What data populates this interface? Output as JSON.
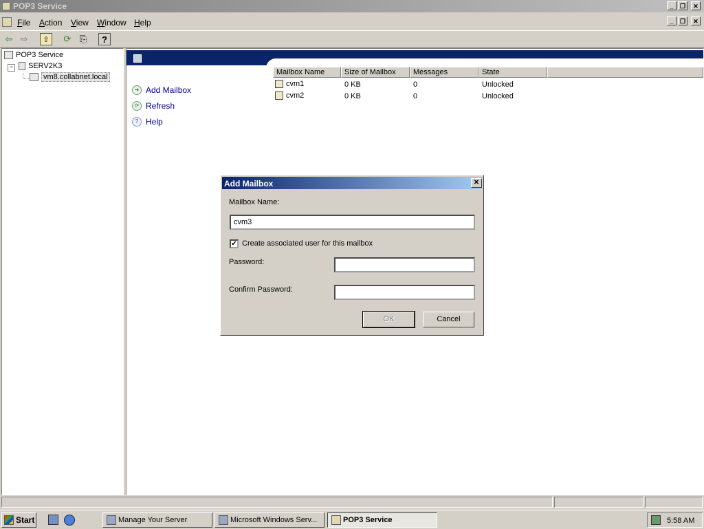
{
  "window": {
    "title": "POP3 Service",
    "min": "_",
    "restore": "❐",
    "close": "✕"
  },
  "menu": {
    "file": {
      "hotkey": "F",
      "rest": "ile"
    },
    "action": {
      "hotkey": "A",
      "rest": "ction"
    },
    "view": {
      "hotkey": "V",
      "rest": "iew"
    },
    "window": {
      "hotkey": "W",
      "rest": "indow"
    },
    "help": {
      "hotkey": "H",
      "rest": "elp"
    }
  },
  "toolbar": {
    "back": "⇦",
    "forward": "⇨",
    "up": "⇧",
    "refresh": "⟳",
    "export": "⎘",
    "helpq": "?"
  },
  "tree": {
    "root": "POP3 Service",
    "server": "SERV2K3",
    "domain": "vm8.collabnet.local",
    "expander": "−"
  },
  "actions": [
    {
      "label": "Add Mailbox",
      "glyph": "➔"
    },
    {
      "label": "Refresh",
      "glyph": "⟳"
    },
    {
      "label": "Help",
      "glyph": "?"
    }
  ],
  "list": {
    "columns": [
      "Mailbox Name",
      "Size of Mailbox",
      "Messages",
      "State"
    ],
    "rows": [
      {
        "name": "cvm1",
        "size": "0 KB",
        "messages": "0",
        "state": "Unlocked"
      },
      {
        "name": "cvm2",
        "size": "0 KB",
        "messages": "0",
        "state": "Unlocked"
      }
    ]
  },
  "dialog": {
    "title": "Add Mailbox",
    "close": "✕",
    "mailbox_label": "Mailbox Name:",
    "mailbox_value": "cvm3",
    "checkbox_label": "Create associated user for this mailbox",
    "checkbox_mark": "✔",
    "password_label": "Password:",
    "password_value": "",
    "confirm_label": "Confirm Password:",
    "confirm_value": "",
    "ok": "OK",
    "cancel": "Cancel"
  },
  "taskbar": {
    "start": "Start",
    "tasks": [
      "Manage Your Server",
      "Microsoft Windows Serv...",
      "POP3 Service"
    ],
    "clock": "5:58 AM"
  }
}
